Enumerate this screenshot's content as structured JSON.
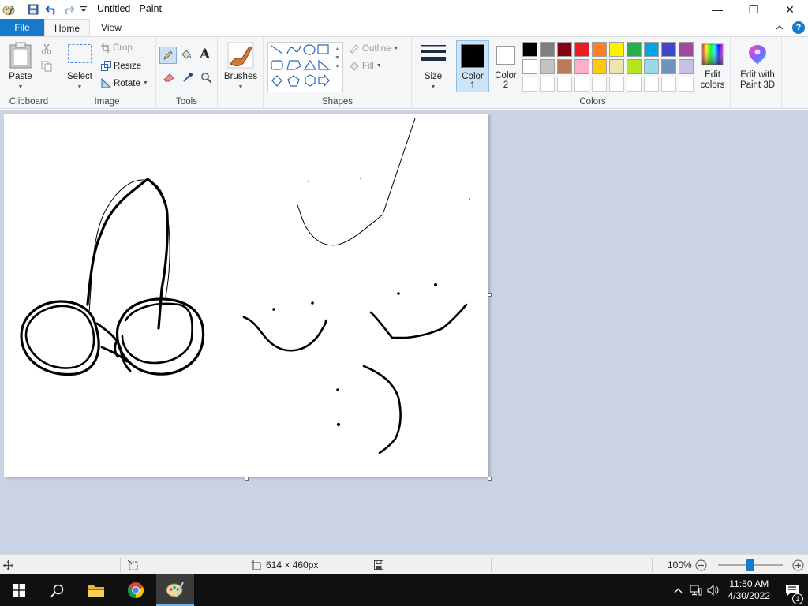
{
  "window": {
    "title": "Untitled - Paint",
    "minimize_icon": "—",
    "maximize_icon": "❐",
    "close_icon": "✕"
  },
  "tabs": [
    {
      "label": "File"
    },
    {
      "label": "Home"
    },
    {
      "label": "View"
    }
  ],
  "help_label": "?",
  "ribbon": {
    "clipboard": {
      "label": "Clipboard",
      "paste": "Paste"
    },
    "image": {
      "label": "Image",
      "select": "Select",
      "crop": "Crop",
      "resize": "Resize",
      "rotate": "Rotate"
    },
    "tools": {
      "label": "Tools"
    },
    "brushes": {
      "label": "Brushes"
    },
    "shapes": {
      "label": "Shapes",
      "outline": "Outline",
      "fill": "Fill"
    },
    "size": {
      "label": "Size"
    },
    "colors": {
      "label": "Colors",
      "color1_label": "Color",
      "color1_num": "1",
      "color2_label": "Color",
      "color2_num": "2",
      "edit_colors_line1": "Edit",
      "edit_colors_line2": "colors",
      "paint3d_line1": "Edit with",
      "paint3d_line2": "Paint 3D",
      "color1_value": "#000000",
      "color2_value": "#ffffff",
      "palette_row1": [
        "#000000",
        "#7f7f7f",
        "#880015",
        "#ed1c24",
        "#ff7f27",
        "#fff200",
        "#22b14c",
        "#00a2e8",
        "#3f48cc",
        "#a349a4"
      ],
      "palette_row2": [
        "#ffffff",
        "#c3c3c3",
        "#b97a57",
        "#ffaec9",
        "#ffc90e",
        "#efe4b0",
        "#b5e61d",
        "#99d9ea",
        "#7092be",
        "#c8bfe7"
      ]
    }
  },
  "status": {
    "canvas_size": "614 × 460px",
    "zoom": "100%",
    "zoom_level": 100
  },
  "taskbar": {
    "time": "11:50 AM",
    "date": "4/30/2022",
    "notification_count": "1"
  }
}
